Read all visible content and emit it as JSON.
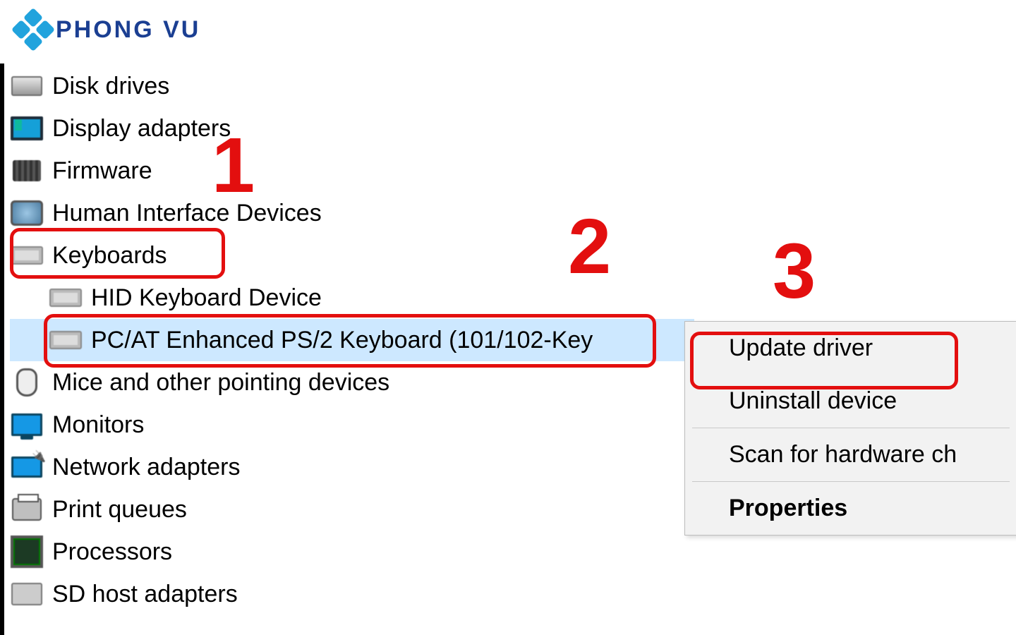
{
  "logo": {
    "text": "PHONG VU"
  },
  "tree": {
    "disk": "Disk drives",
    "display": "Display adapters",
    "firmware": "Firmware",
    "hid": "Human Interface Devices",
    "keyboards": "Keyboards",
    "kb_hid": "HID Keyboard Device",
    "kb_ps2": "PC/AT Enhanced PS/2 Keyboard (101/102-Key",
    "mice": "Mice and other pointing devices",
    "monitors": "Monitors",
    "network": "Network adapters",
    "printq": "Print queues",
    "cpu": "Processors",
    "sd": "SD host adapters"
  },
  "ctx": {
    "update": "Update driver",
    "uninstall": "Uninstall device",
    "scan": "Scan for hardware ch",
    "props": "Properties"
  },
  "steps": {
    "s1": "1",
    "s2": "2",
    "s3": "3"
  }
}
